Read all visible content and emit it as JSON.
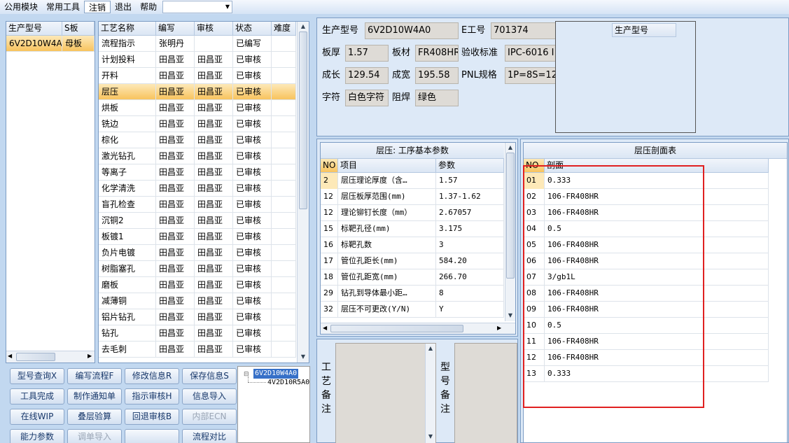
{
  "menu": {
    "items": [
      "公用模块",
      "常用工具",
      "注销",
      "退出",
      "帮助"
    ]
  },
  "model_list": {
    "headers": [
      "生产型号",
      "S板"
    ],
    "rows": [
      [
        "6V2D10W4A0",
        "母板"
      ]
    ]
  },
  "process": {
    "headers": [
      "工艺名称",
      "编写",
      "审核",
      "状态",
      "难度"
    ],
    "rows": [
      [
        "流程指示",
        "张明丹",
        "",
        "已编写",
        ""
      ],
      [
        "计划投料",
        "田昌亚",
        "田昌亚",
        "已审核",
        ""
      ],
      [
        "开料",
        "田昌亚",
        "田昌亚",
        "已审核",
        ""
      ],
      [
        "层压",
        "田昌亚",
        "田昌亚",
        "已审核",
        ""
      ],
      [
        "烘板",
        "田昌亚",
        "田昌亚",
        "已审核",
        ""
      ],
      [
        "铣边",
        "田昌亚",
        "田昌亚",
        "已审核",
        ""
      ],
      [
        "棕化",
        "田昌亚",
        "田昌亚",
        "已审核",
        ""
      ],
      [
        "激光钻孔",
        "田昌亚",
        "田昌亚",
        "已审核",
        ""
      ],
      [
        "等离子",
        "田昌亚",
        "田昌亚",
        "已审核",
        ""
      ],
      [
        "化学清洗",
        "田昌亚",
        "田昌亚",
        "已审核",
        ""
      ],
      [
        "盲孔检查",
        "田昌亚",
        "田昌亚",
        "已审核",
        ""
      ],
      [
        "沉铜2",
        "田昌亚",
        "田昌亚",
        "已审核",
        ""
      ],
      [
        "板镀1",
        "田昌亚",
        "田昌亚",
        "已审核",
        ""
      ],
      [
        "负片电镀",
        "田昌亚",
        "田昌亚",
        "已审核",
        ""
      ],
      [
        "树脂塞孔",
        "田昌亚",
        "田昌亚",
        "已审核",
        ""
      ],
      [
        "磨板",
        "田昌亚",
        "田昌亚",
        "已审核",
        ""
      ],
      [
        "减薄铜",
        "田昌亚",
        "田昌亚",
        "已审核",
        ""
      ],
      [
        "铝片钻孔",
        "田昌亚",
        "田昌亚",
        "已审核",
        ""
      ],
      [
        "钻孔",
        "田昌亚",
        "田昌亚",
        "已审核",
        ""
      ],
      [
        "去毛刺",
        "田昌亚",
        "田昌亚",
        "已审核",
        ""
      ]
    ]
  },
  "buttons": {
    "r1": [
      "型号查询X",
      "编写流程F",
      "修改信息R",
      "保存信息S"
    ],
    "r2": [
      "工具完成",
      "制作通知单",
      "指示审核H",
      "信息导入"
    ],
    "r3": [
      "在线WIP",
      "叠层验算",
      "回退审核B",
      "内部ECN"
    ],
    "r4": [
      "能力参数",
      "调单导入",
      "",
      "流程对比"
    ]
  },
  "tree": {
    "root": "6V2D10W4A0",
    "child": "4V2D10R5A0"
  },
  "info": {
    "labels": {
      "model": "生产型号",
      "eno": "E工号",
      "thick": "板厚",
      "material": "板材",
      "std": "验收标准",
      "len": "成长",
      "wid": "成宽",
      "pnl": "PNL规格",
      "char": "字符",
      "mask": "阻焊",
      "side_header": "生产型号"
    },
    "values": {
      "model": "6V2D10W4A0",
      "eno": "701374",
      "thick": "1.57",
      "material": "FR408HR",
      "std": "IPC-6016 I",
      "len": "129.54",
      "wid": "195.58",
      "pnl": "1P=8S=12",
      "char": "白色字符",
      "mask": "绿色"
    }
  },
  "params": {
    "title": "层压: 工序基本参数",
    "headers": [
      "NO",
      "项目",
      "参数"
    ],
    "rows": [
      [
        "2",
        "层压理论厚度（含…",
        "1.57"
      ],
      [
        "12",
        "层压板厚范围(mm)",
        "1.37-1.62"
      ],
      [
        "12",
        "理论铆钉长度（mm）",
        "2.67057"
      ],
      [
        "15",
        "标靶孔径(mm)",
        "3.175"
      ],
      [
        "16",
        "标靶孔数",
        "3"
      ],
      [
        "17",
        "管位孔距长(mm)",
        "584.20"
      ],
      [
        "18",
        "管位孔距宽(mm)",
        "266.70"
      ],
      [
        "29",
        "钻孔到导体最小距…",
        "8"
      ],
      [
        "32",
        "层压不可更改(Y/N)",
        "Y"
      ]
    ]
  },
  "stack": {
    "title": "层压剖面表",
    "headers": [
      "NO",
      "剖面"
    ],
    "rows": [
      [
        "01",
        "0.333"
      ],
      [
        "02",
        "106-FR408HR"
      ],
      [
        "03",
        "106-FR408HR"
      ],
      [
        "04",
        "0.5"
      ],
      [
        "05",
        "106-FR408HR"
      ],
      [
        "06",
        "106-FR408HR"
      ],
      [
        "07",
        "3/gb1L"
      ],
      [
        "08",
        "106-FR408HR"
      ],
      [
        "09",
        "106-FR408HR"
      ],
      [
        "10",
        "0.5"
      ],
      [
        "11",
        "106-FR408HR"
      ],
      [
        "12",
        "106-FR408HR"
      ],
      [
        "13",
        "0.333"
      ]
    ]
  },
  "notes": {
    "process_label": "工艺备注",
    "model_label": "型号备注"
  },
  "colors": {
    "selection": "#f8c35e",
    "highlight_box": "#e02020"
  }
}
